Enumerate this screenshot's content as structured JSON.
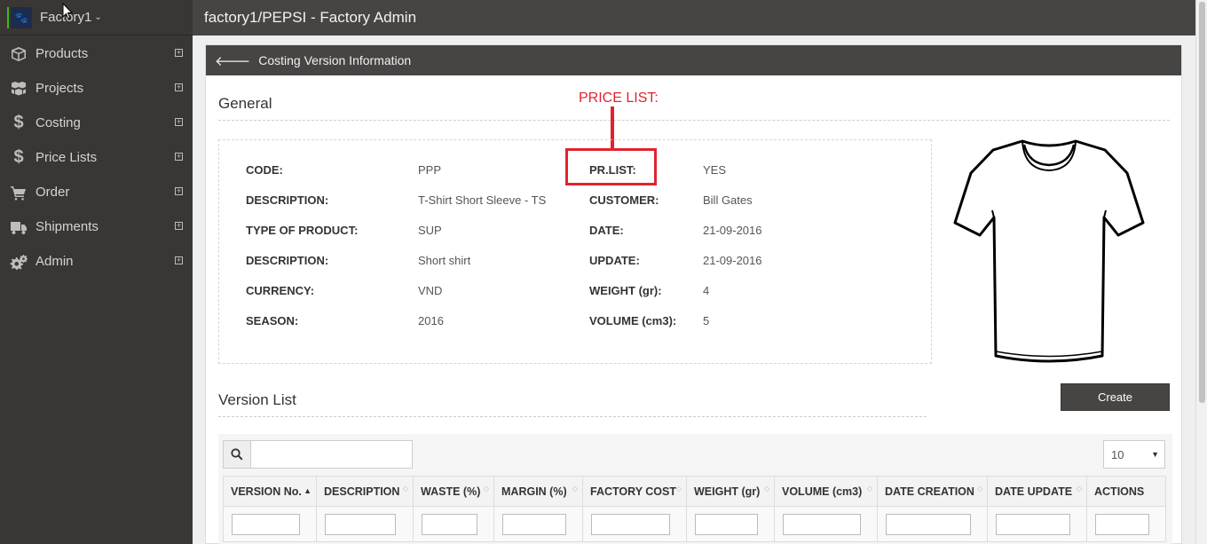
{
  "brand": {
    "name": "Factory1",
    "caret": "⌄"
  },
  "sidebar": {
    "items": [
      {
        "label": "Products",
        "icon": "cube-icon"
      },
      {
        "label": "Projects",
        "icon": "cubes-icon"
      },
      {
        "label": "Costing",
        "icon": "dollar-icon"
      },
      {
        "label": "Price Lists",
        "icon": "dollar-icon"
      },
      {
        "label": "Order",
        "icon": "cart-icon"
      },
      {
        "label": "Shipments",
        "icon": "truck-icon"
      },
      {
        "label": "Admin",
        "icon": "gears-icon"
      }
    ],
    "expand_symbol": "+"
  },
  "header": {
    "title": "factory1/PEPSI - Factory Admin"
  },
  "panel": {
    "title": "Costing Version Information"
  },
  "general": {
    "title": "General",
    "left": [
      {
        "label": "CODE:",
        "value": "PPP"
      },
      {
        "label": "DESCRIPTION:",
        "value": "T-Shirt Short Sleeve - TS"
      },
      {
        "label": "TYPE OF PRODUCT:",
        "value": "SUP"
      },
      {
        "label": "DESCRIPTION:",
        "value": "Short shirt"
      },
      {
        "label": "CURRENCY:",
        "value": "VND"
      },
      {
        "label": "SEASON:",
        "value": "2016"
      }
    ],
    "right": [
      {
        "label": "PR.LIST:",
        "value": "YES"
      },
      {
        "label": "CUSTOMER:",
        "value": "Bill Gates"
      },
      {
        "label": "DATE:",
        "value": "21-09-2016"
      },
      {
        "label": "UPDATE:",
        "value": "21-09-2016"
      },
      {
        "label": "WEIGHT (gr):",
        "value": "4"
      },
      {
        "label": "VOLUME (cm3):",
        "value": "5"
      }
    ]
  },
  "annotation": {
    "text": "PRICE LIST:",
    "color": "#e0232e"
  },
  "version_list": {
    "title": "Version List",
    "create_label": "Create",
    "page_size": "10",
    "columns": [
      "VERSION No.",
      "DESCRIPTION",
      "WASTE (%)",
      "MARGIN (%)",
      "FACTORY COST",
      "WEIGHT (gr)",
      "VOLUME (cm3)",
      "DATE CREATION",
      "DATE UPDATE",
      "ACTIONS"
    ]
  },
  "colors": {
    "sidebar": "#3a3633",
    "topbar": "#474544",
    "accent_green": "#3fb618"
  }
}
